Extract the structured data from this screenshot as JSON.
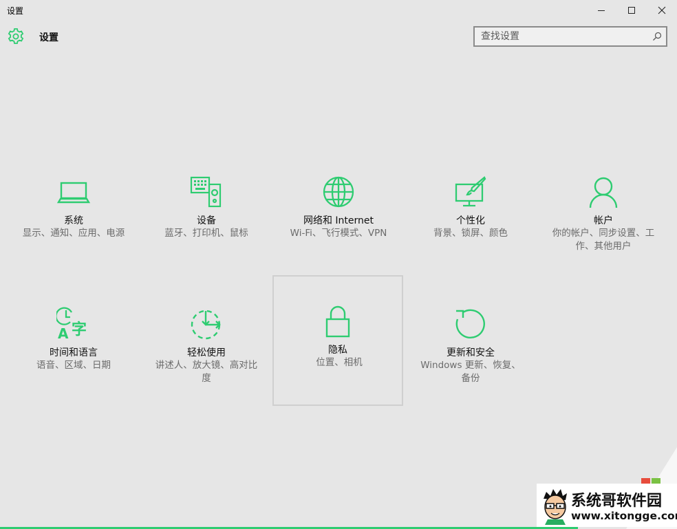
{
  "window": {
    "title": "设置",
    "controls": [
      {
        "name": "minimize",
        "icon": "minimize-icon"
      },
      {
        "name": "maximize",
        "icon": "maximize-icon"
      },
      {
        "name": "close",
        "icon": "close-icon"
      }
    ]
  },
  "header": {
    "icon": "gear-icon",
    "title": "设置"
  },
  "search": {
    "value": "",
    "placeholder": "查找设置",
    "icon": "search-icon"
  },
  "colors": {
    "accent": "#2ecc71",
    "background": "#e6e6e6",
    "desc_text": "#6b6b6b"
  },
  "tiles": [
    {
      "icon": "laptop-icon",
      "label": "系统",
      "desc": "显示、通知、应用、电源"
    },
    {
      "icon": "devices-icon",
      "label": "设备",
      "desc": "蓝牙、打印机、鼠标"
    },
    {
      "icon": "globe-icon",
      "label": "网络和 Internet",
      "desc": "Wi-Fi、飞行模式、VPN"
    },
    {
      "icon": "personalization-icon",
      "label": "个性化",
      "desc": "背景、锁屏、颜色"
    },
    {
      "icon": "person-icon",
      "label": "帐户",
      "desc": "你的帐户、同步设置、工作、其他用户"
    },
    {
      "icon": "time-language-icon",
      "label": "时间和语言",
      "desc": "语音、区域、日期"
    },
    {
      "icon": "ease-of-access-icon",
      "label": "轻松使用",
      "desc": "讲述人、放大镜、高对比度"
    },
    {
      "icon": "lock-icon",
      "label": "隐私",
      "desc": "位置、相机",
      "selected": true
    },
    {
      "icon": "update-icon",
      "label": "更新和安全",
      "desc": "Windows 更新、恢复、备份"
    }
  ],
  "watermark": {
    "title": "系统哥软件园",
    "url": "www.xitongge.com",
    "icon": "cartoon-face-icon"
  }
}
